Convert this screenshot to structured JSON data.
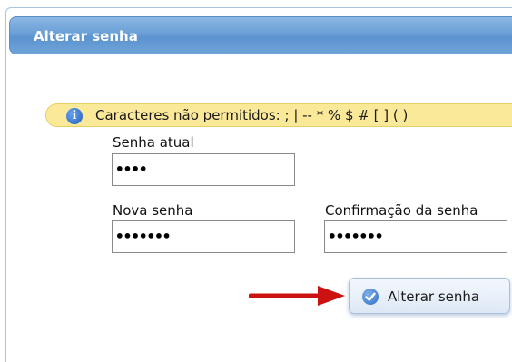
{
  "dialog": {
    "title": "Alterar senha"
  },
  "notice": {
    "icon": "info-icon",
    "text": "Caracteres não permitidos: ; | -- * % $ # [ ] ( )"
  },
  "form": {
    "current_password": {
      "label": "Senha atual",
      "value": "••••"
    },
    "new_password": {
      "label": "Nova senha",
      "value": "•••••••"
    },
    "confirm_password": {
      "label": "Confirmação da senha",
      "value": "•••••••"
    }
  },
  "actions": {
    "submit_label": "Alterar senha",
    "submit_icon": "check-circle-icon"
  },
  "colors": {
    "title_bar": "#6a9fd6",
    "notice_bg": "#fbe99a",
    "arrow": "#cc1111"
  }
}
